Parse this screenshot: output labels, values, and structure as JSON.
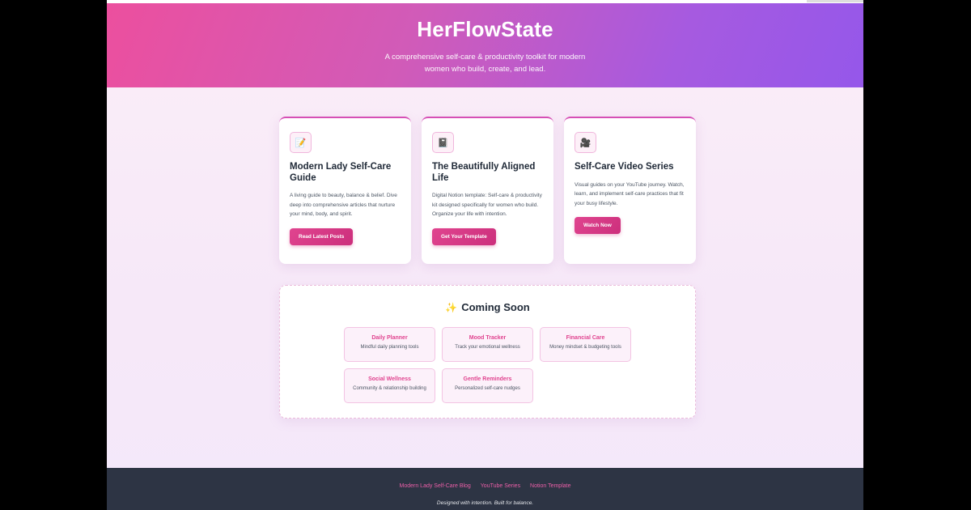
{
  "header": {
    "title": "HerFlowState",
    "subtitle": "A comprehensive self-care & productivity toolkit for modern women who build, create, and lead."
  },
  "cards": [
    {
      "icon": "memo-icon",
      "glyph": "📝",
      "title": "Modern Lady Self-Care Guide",
      "description": "A living guide to beauty, balance & belief. Dive deep into comprehensive articles that nurture your mind, body, and spirit.",
      "button": "Read Latest Posts"
    },
    {
      "icon": "notebook-icon",
      "glyph": "📓",
      "title": "The Beautifully Aligned Life",
      "description": "Digital Notion template: Self-care & productivity kit designed specifically for women who build. Organize your life with intention.",
      "button": "Get Your Template"
    },
    {
      "icon": "video-camera-icon",
      "glyph": "🎥",
      "title": "Self-Care Video Series",
      "description": "Visual guides on your YouTube journey. Watch, learn, and implement self-care practices that fit your busy lifestyle.",
      "button": "Watch Now"
    }
  ],
  "coming_soon": {
    "icon": "sparkles-icon",
    "glyph": "✨",
    "title": "Coming Soon",
    "features": [
      {
        "title": "Daily Planner",
        "description": "Mindful daily planning tools"
      },
      {
        "title": "Mood Tracker",
        "description": "Track your emotional wellness"
      },
      {
        "title": "Financial Care",
        "description": "Money mindset & budgeting tools"
      },
      {
        "title": "Social Wellness",
        "description": "Community & relationship building"
      },
      {
        "title": "Gentle Reminders",
        "description": "Personalized self-care nudges"
      }
    ]
  },
  "footer": {
    "links": [
      "Modern Lady Self-Care Blog",
      "YouTube Series",
      "Notion Template"
    ],
    "tagline": "Designed with intention. Built for balance."
  },
  "colors": {
    "accent": "#e0448f",
    "hero_start": "#ec4f9e",
    "hero_end": "#9557ea",
    "footer_bg": "#2d3444"
  }
}
